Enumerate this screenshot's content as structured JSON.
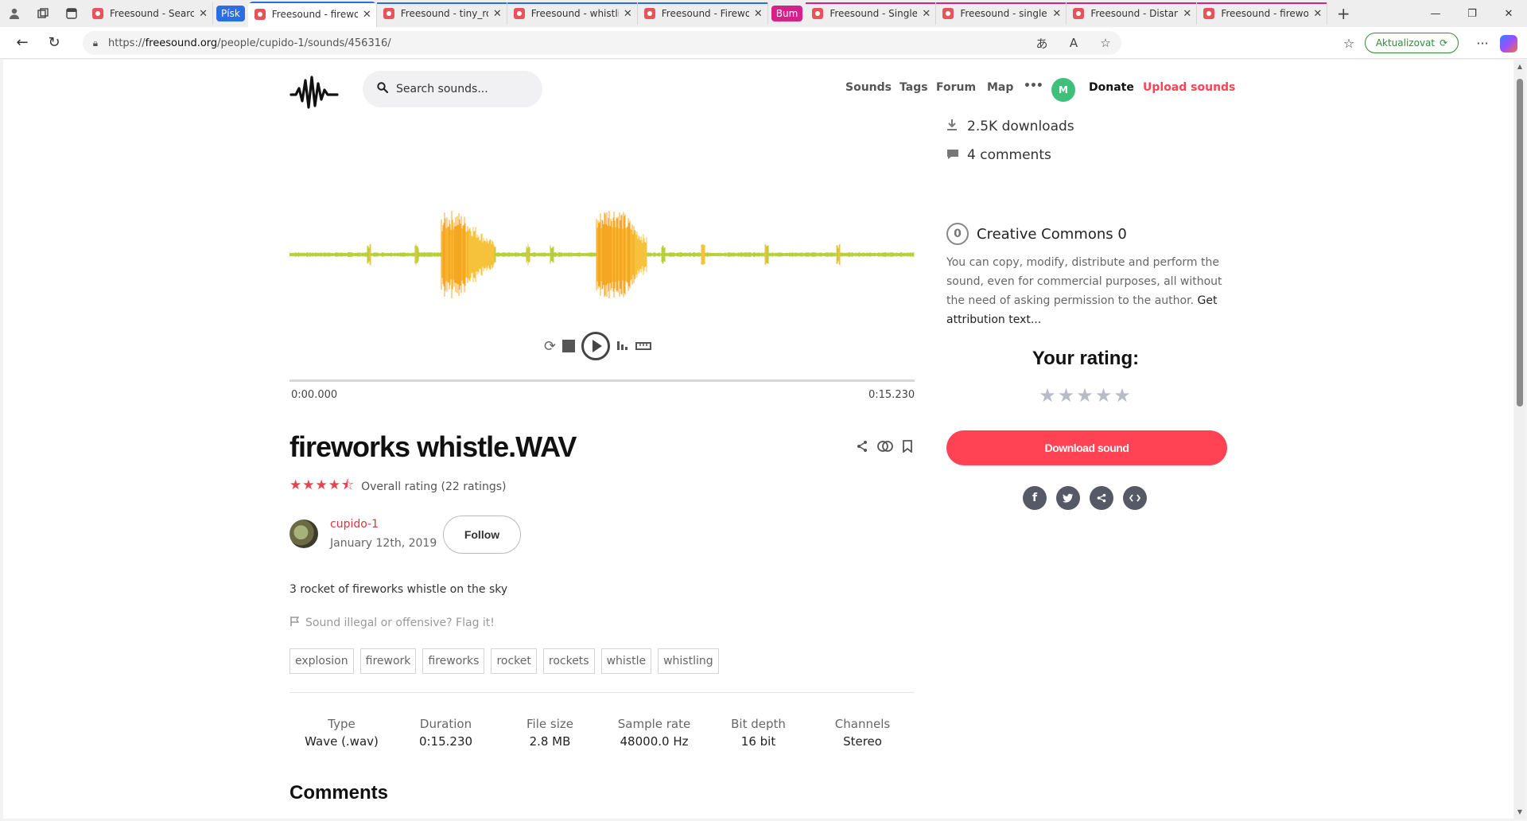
{
  "browser": {
    "tabs": [
      {
        "title": "Freesound - Search",
        "active": false
      },
      {
        "title": "Freesound - firewo",
        "active": true
      },
      {
        "title": "Freesound - tiny_ro",
        "active": false
      },
      {
        "title": "Freesound - whistli",
        "active": false
      },
      {
        "title": "Freesound - Firewo",
        "active": false
      },
      {
        "title": "Freesound - Single",
        "active": false
      },
      {
        "title": "Freesound - single",
        "active": false
      },
      {
        "title": "Freesound - Distan",
        "active": false
      },
      {
        "title": "Freesound - firewo",
        "active": false
      }
    ],
    "groups": {
      "pisk": "Písk",
      "bum": "Bum"
    },
    "group_colors": {
      "pisk": "#2b6de5",
      "bum": "#d6208a"
    },
    "url_prefix": "https://",
    "url_host": "freesound.org",
    "url_path": "/people/cupido-1/sounds/456316/",
    "update_label": "Aktualizovat"
  },
  "site": {
    "search_placeholder": "Search sounds...",
    "nav": {
      "sounds": "Sounds",
      "tags": "Tags",
      "forum": "Forum",
      "map": "Map",
      "more": "•••"
    },
    "avatar_letter": "M",
    "donate": "Donate",
    "upload": "Upload sounds",
    "accent_color": "#ff4354"
  },
  "player": {
    "time_start": "0:00.000",
    "time_end": "0:15.230",
    "progress": 0
  },
  "sound": {
    "title": "fireworks whistle.WAV",
    "rating_stars": 4.5,
    "rating_label": "Overall rating (22 ratings)",
    "username": "cupido-1",
    "date": "January 12th, 2019",
    "follow_label": "Follow",
    "description": "3 rocket of fireworks whistle on the sky",
    "flag_label": "Sound illegal or offensive? Flag it!",
    "tags": [
      "explosion",
      "firework",
      "fireworks",
      "rocket",
      "rockets",
      "whistle",
      "whistling"
    ],
    "meta": [
      {
        "k": "Type",
        "v": "Wave (.wav)"
      },
      {
        "k": "Duration",
        "v": "0:15.230"
      },
      {
        "k": "File size",
        "v": "2.8 MB"
      },
      {
        "k": "Sample rate",
        "v": "48000.0 Hz"
      },
      {
        "k": "Bit depth",
        "v": "16 bit"
      },
      {
        "k": "Channels",
        "v": "Stereo"
      }
    ],
    "comments_heading": "Comments"
  },
  "sidebar": {
    "downloads": "2.5K downloads",
    "comments": "4 comments",
    "license_icon": "0",
    "license": "Creative Commons 0",
    "license_text": "You can copy, modify, distribute and perform the sound, even for commercial purposes, all without the need of asking permission to the author.",
    "attribution_link": "Get attribution text...",
    "your_rating": "Your rating:",
    "user_rating_stars": 0,
    "download_label": "Download sound",
    "share": {
      "facebook": "f",
      "twitter": "t",
      "share": "<",
      "embed": "<>"
    }
  }
}
